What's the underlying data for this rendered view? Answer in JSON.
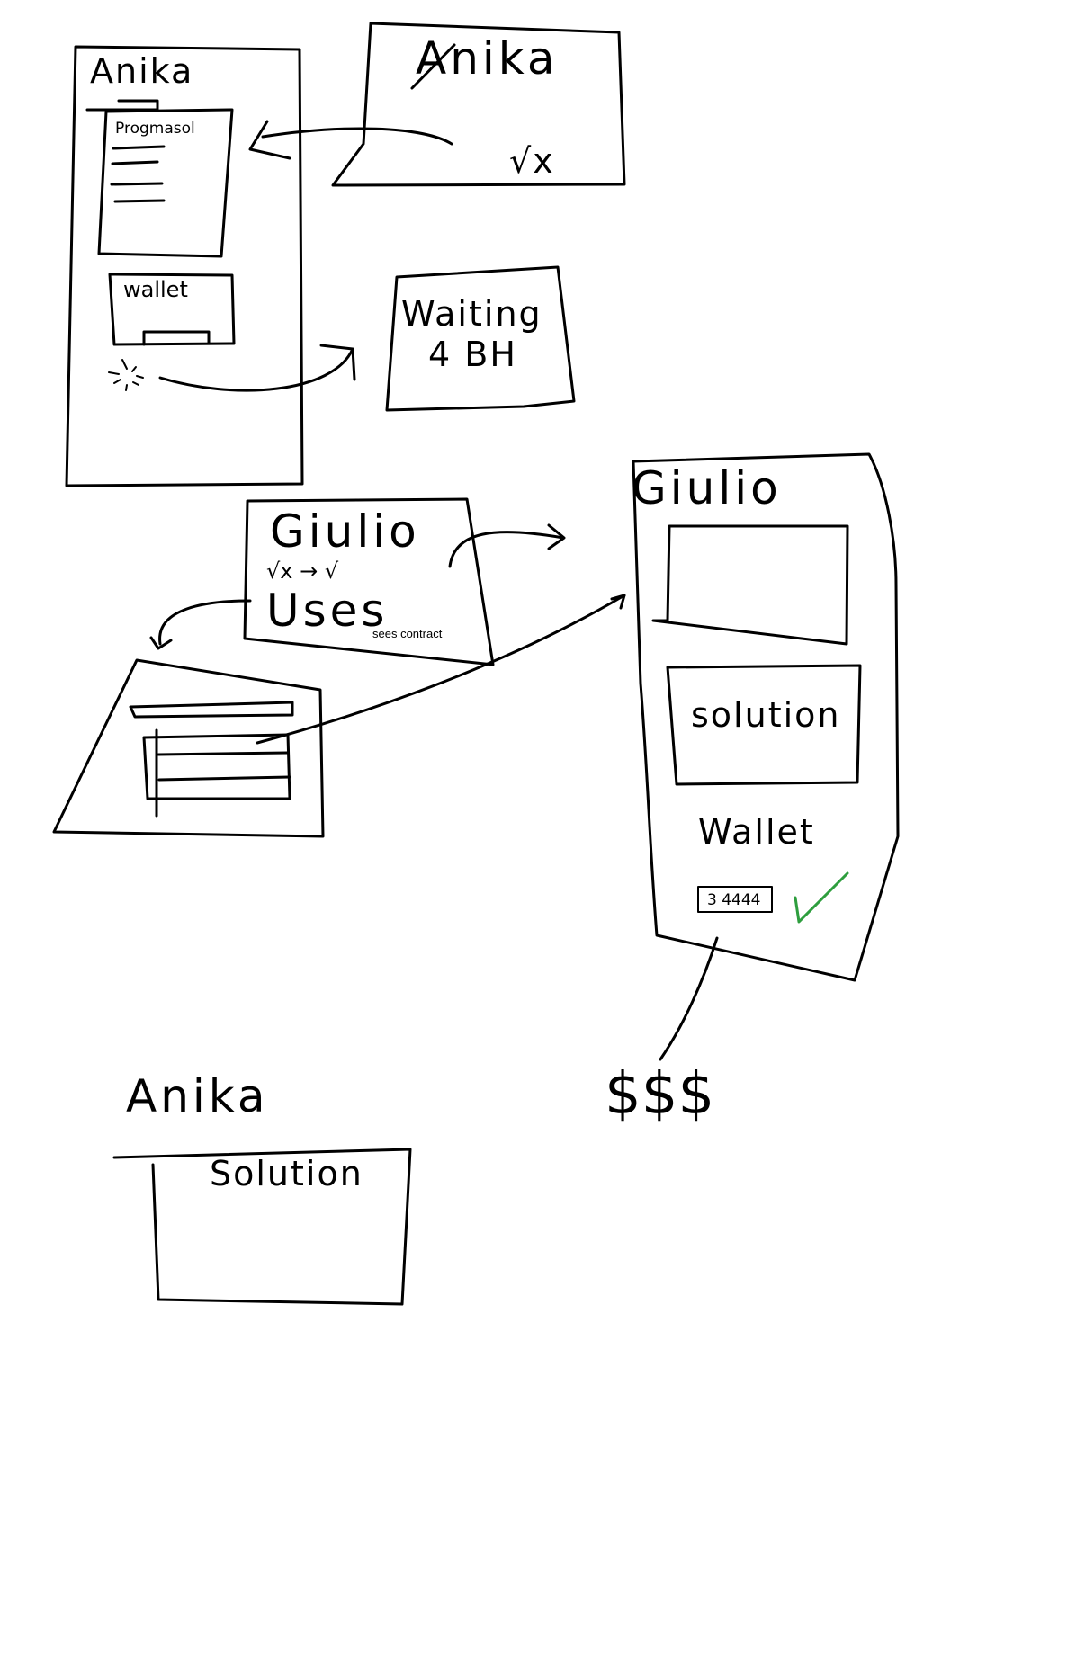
{
  "labels": {
    "anika_phone_title": "Anika",
    "anika_phone_panel": "Progmasol",
    "anika_phone_wallet": "wallet",
    "anika_screen_title": "Anika",
    "anika_screen_symbol": "√x",
    "waiting_line1": "Waiting",
    "waiting_line2": "4 BH",
    "giulio_card_title": "Giulio",
    "giulio_card_formula": "√x → √",
    "giulio_card_uses": "Uses",
    "giulio_card_note": "sees contract",
    "giulio_phone_title": "Giulio",
    "giulio_phone_solution": "solution",
    "giulio_phone_wallet": "Wallet",
    "giulio_phone_amount": "3 4444",
    "payout": "$$$",
    "anika_bottom_title": "Anika",
    "anika_bottom_solution": "Solution"
  },
  "colors": {
    "ink": "#000000",
    "check": "#2e9e3e",
    "background": "#ffffff"
  },
  "icons": {
    "loading": "spinner-icon",
    "approved": "checkmark-icon"
  }
}
